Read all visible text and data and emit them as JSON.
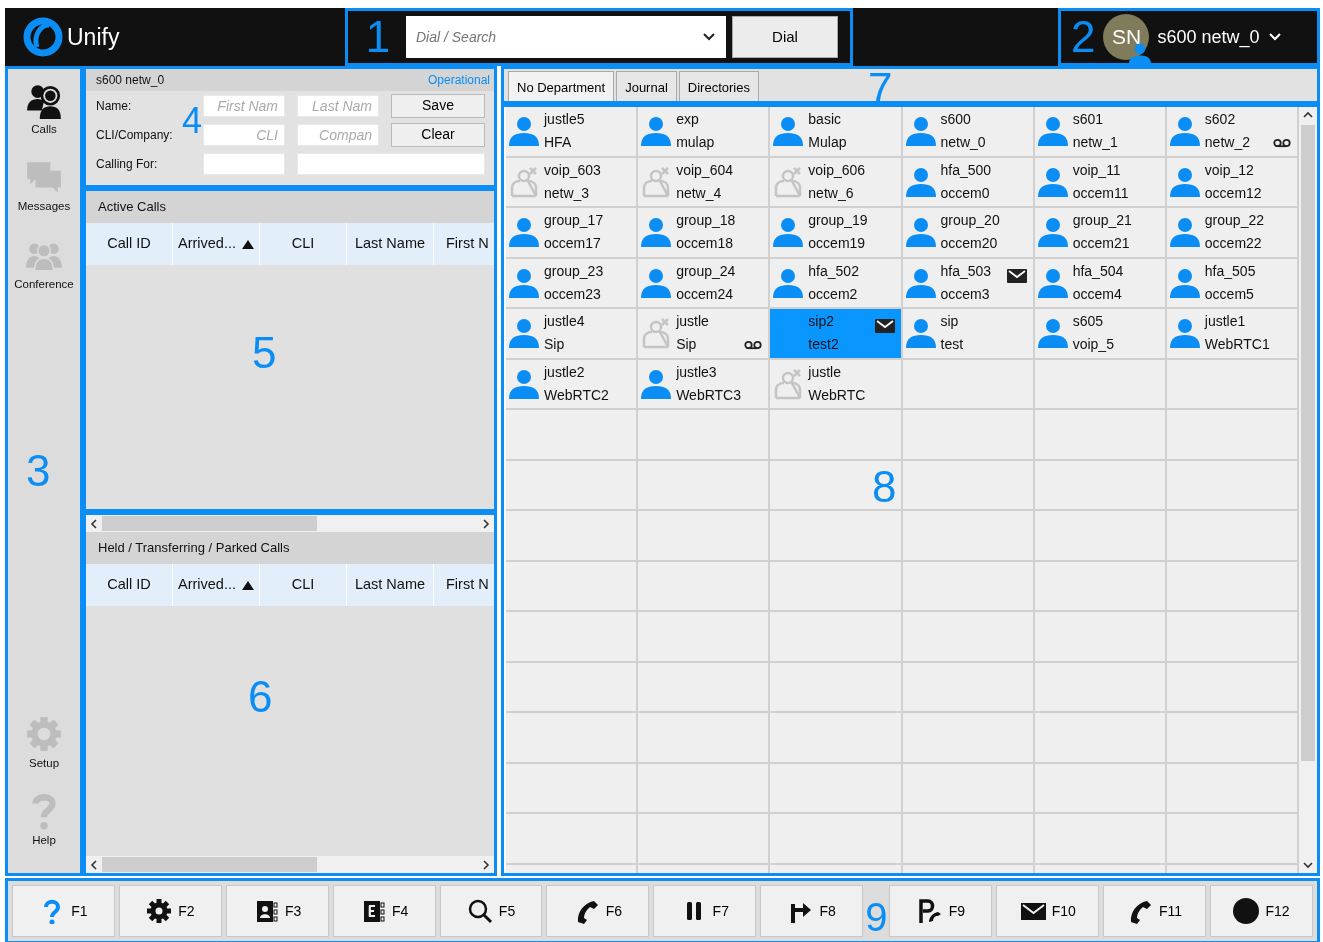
{
  "app": {
    "logo": "Unify"
  },
  "dial": {
    "placeholder": "Dial / Search",
    "button": "Dial"
  },
  "user": {
    "initials": "SN",
    "name": "s600 netw_0"
  },
  "sidebar": {
    "top": [
      {
        "label": "Calls",
        "kind": "calls",
        "selected": true
      },
      {
        "label": "Messages",
        "kind": "messages",
        "selected": false
      },
      {
        "label": "Conference",
        "kind": "conference",
        "selected": false
      }
    ],
    "bottom": [
      {
        "label": "Setup",
        "kind": "setup",
        "selected": false
      },
      {
        "label": "Help",
        "kind": "help",
        "selected": false
      }
    ]
  },
  "caller": {
    "title": "s600 netw_0",
    "status": "Operational",
    "rows": [
      {
        "label": "Name:",
        "kind": "pair",
        "fields": [
          {
            "placeholder": "First Nam"
          },
          {
            "placeholder": "Last Nam"
          }
        ],
        "button": "Save"
      },
      {
        "label": "CLI/Company:",
        "kind": "pair",
        "fields": [
          {
            "placeholder": "CLI"
          },
          {
            "placeholder": "Compan"
          }
        ],
        "button": "Clear"
      },
      {
        "label": "Calling For:",
        "kind": "blank"
      }
    ]
  },
  "active_calls": {
    "title": "Active Calls",
    "columns": [
      {
        "label": "Call ID",
        "sorted_ascending": false
      },
      {
        "label": "Arrived...",
        "sorted_ascending": true
      },
      {
        "label": "CLI",
        "sorted_ascending": false
      },
      {
        "label": "Last Name",
        "sorted_ascending": false
      },
      {
        "label": "First N",
        "sorted_ascending": false
      }
    ]
  },
  "held_calls": {
    "title": "Held / Transferring / Parked Calls",
    "columns": [
      {
        "label": "Call ID",
        "sorted_ascending": false
      },
      {
        "label": "Arrived...",
        "sorted_ascending": true
      },
      {
        "label": "CLI",
        "sorted_ascending": false
      },
      {
        "label": "Last Name",
        "sorted_ascending": false
      },
      {
        "label": "First N",
        "sorted_ascending": false
      }
    ]
  },
  "tabs": [
    {
      "label": "No Department",
      "selected": true
    },
    {
      "label": "Journal",
      "selected": false
    },
    {
      "label": "Directories",
      "selected": false
    }
  ],
  "contacts": [
    {
      "name": "justle5",
      "sub": "HFA",
      "kind": "available",
      "selected": false,
      "message": false,
      "voicemail": false
    },
    {
      "name": "exp",
      "sub": "mulap",
      "kind": "available",
      "selected": false,
      "message": false,
      "voicemail": false
    },
    {
      "name": "basic",
      "sub": "Mulap",
      "kind": "available",
      "selected": false,
      "message": false,
      "voicemail": false
    },
    {
      "name": "s600",
      "sub": "netw_0",
      "kind": "available",
      "selected": false,
      "message": false,
      "voicemail": false
    },
    {
      "name": "s601",
      "sub": "netw_1",
      "kind": "available",
      "selected": false,
      "message": false,
      "voicemail": false
    },
    {
      "name": "s602",
      "sub": "netw_2",
      "kind": "available",
      "selected": false,
      "message": false,
      "voicemail": true
    },
    {
      "name": "voip_603",
      "sub": "netw_3",
      "kind": "offline",
      "selected": false,
      "message": false,
      "voicemail": false
    },
    {
      "name": "voip_604",
      "sub": "netw_4",
      "kind": "offline",
      "selected": false,
      "message": false,
      "voicemail": false
    },
    {
      "name": "voip_606",
      "sub": "netw_6",
      "kind": "offline",
      "selected": false,
      "message": false,
      "voicemail": false
    },
    {
      "name": "hfa_500",
      "sub": "occem0",
      "kind": "available",
      "selected": false,
      "message": false,
      "voicemail": false
    },
    {
      "name": "voip_11",
      "sub": "occem11",
      "kind": "available",
      "selected": false,
      "message": false,
      "voicemail": false
    },
    {
      "name": "voip_12",
      "sub": "occem12",
      "kind": "available",
      "selected": false,
      "message": false,
      "voicemail": false
    },
    {
      "name": "group_17",
      "sub": "occem17",
      "kind": "available",
      "selected": false,
      "message": false,
      "voicemail": false
    },
    {
      "name": "group_18",
      "sub": "occem18",
      "kind": "available",
      "selected": false,
      "message": false,
      "voicemail": false
    },
    {
      "name": "group_19",
      "sub": "occem19",
      "kind": "available",
      "selected": false,
      "message": false,
      "voicemail": false
    },
    {
      "name": "group_20",
      "sub": "occem20",
      "kind": "available",
      "selected": false,
      "message": false,
      "voicemail": false
    },
    {
      "name": "group_21",
      "sub": "occem21",
      "kind": "available",
      "selected": false,
      "message": false,
      "voicemail": false
    },
    {
      "name": "group_22",
      "sub": "occem22",
      "kind": "available",
      "selected": false,
      "message": false,
      "voicemail": false
    },
    {
      "name": "group_23",
      "sub": "occem23",
      "kind": "available",
      "selected": false,
      "message": false,
      "voicemail": false
    },
    {
      "name": "group_24",
      "sub": "occem24",
      "kind": "available",
      "selected": false,
      "message": false,
      "voicemail": false
    },
    {
      "name": "hfa_502",
      "sub": "occem2",
      "kind": "available",
      "selected": false,
      "message": false,
      "voicemail": false
    },
    {
      "name": "hfa_503",
      "sub": "occem3",
      "kind": "available",
      "selected": false,
      "message": true,
      "voicemail": false
    },
    {
      "name": "hfa_504",
      "sub": "occem4",
      "kind": "available",
      "selected": false,
      "message": false,
      "voicemail": false
    },
    {
      "name": "hfa_505",
      "sub": "occem5",
      "kind": "available",
      "selected": false,
      "message": false,
      "voicemail": false
    },
    {
      "name": "justle4",
      "sub": "Sip",
      "kind": "available",
      "selected": false,
      "message": false,
      "voicemail": false
    },
    {
      "name": "justle",
      "sub": "Sip",
      "kind": "offline",
      "selected": false,
      "message": false,
      "voicemail": true
    },
    {
      "name": "sip2",
      "sub": "test2",
      "kind": "none",
      "selected": true,
      "message": true,
      "voicemail": false
    },
    {
      "name": "sip",
      "sub": "test",
      "kind": "available",
      "selected": false,
      "message": false,
      "voicemail": false
    },
    {
      "name": "s605",
      "sub": "voip_5",
      "kind": "available",
      "selected": false,
      "message": false,
      "voicemail": false
    },
    {
      "name": "justle1",
      "sub": "WebRTC1",
      "kind": "available",
      "selected": false,
      "message": false,
      "voicemail": false
    },
    {
      "name": "justle2",
      "sub": "WebRTC2",
      "kind": "available",
      "selected": false,
      "message": false,
      "voicemail": false
    },
    {
      "name": "justle3",
      "sub": "WebRTC3",
      "kind": "available",
      "selected": false,
      "message": false,
      "voicemail": false
    },
    {
      "name": "justle",
      "sub": "WebRTC",
      "kind": "offline",
      "selected": false,
      "message": false,
      "voicemail": false
    }
  ],
  "function_keys": [
    {
      "label": "F1",
      "kind": "help"
    },
    {
      "label": "F2",
      "kind": "gear"
    },
    {
      "label": "F3",
      "kind": "card"
    },
    {
      "label": "F4",
      "kind": "card-e"
    },
    {
      "label": "F5",
      "kind": "search"
    },
    {
      "label": "F6",
      "kind": "phone"
    },
    {
      "label": "F7",
      "kind": "pause"
    },
    {
      "label": "F8",
      "kind": "redirect"
    },
    {
      "label": "F9",
      "kind": "park"
    },
    {
      "label": "F10",
      "kind": "mail"
    },
    {
      "label": "F11",
      "kind": "phone"
    },
    {
      "label": "F12",
      "kind": "record"
    }
  ],
  "callouts": [
    "1",
    "2",
    "3",
    "4",
    "5",
    "6",
    "7",
    "8",
    "9"
  ]
}
